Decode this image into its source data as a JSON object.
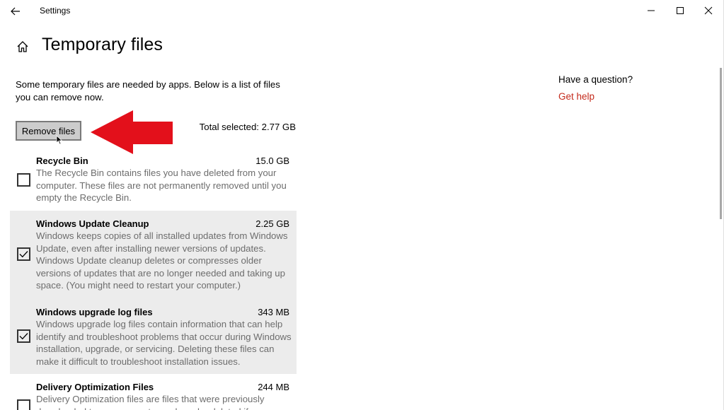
{
  "window": {
    "title": "Settings"
  },
  "page": {
    "title": "Temporary files",
    "intro": "Some temporary files are needed by apps. Below is a list of files you can remove now.",
    "remove_button": "Remove files",
    "total_selected": "Total selected: 2.77 GB"
  },
  "sidebar": {
    "question": "Have a question?",
    "help_link": "Get help"
  },
  "items": [
    {
      "name": "Recycle Bin",
      "size": "15.0 GB",
      "checked": false,
      "description": "The Recycle Bin contains files you have deleted from your computer. These files are not permanently removed until you empty the Recycle Bin."
    },
    {
      "name": "Windows Update Cleanup",
      "size": "2.25 GB",
      "checked": true,
      "description": "Windows keeps copies of all installed updates from Windows Update, even after installing newer versions of updates. Windows Update cleanup deletes or compresses older versions of updates that are no longer needed and taking up space. (You might need to restart your computer.)"
    },
    {
      "name": "Windows upgrade log files",
      "size": "343 MB",
      "checked": true,
      "description": "Windows upgrade log files contain information that can help identify and troubleshoot problems that occur during Windows installation, upgrade, or servicing.  Deleting these files can make it difficult to troubleshoot installation issues."
    },
    {
      "name": "Delivery Optimization Files",
      "size": "244 MB",
      "checked": false,
      "description": "Delivery Optimization files are files that were previously downloaded to your computer and can be deleted if"
    }
  ],
  "colors": {
    "accent_link": "#c42b1c",
    "arrow": "#e3101b",
    "selected_row": "#ececec"
  },
  "icons": [
    "back-arrow-icon",
    "home-icon",
    "minimize-icon",
    "maximize-icon",
    "close-icon",
    "checkmark-icon",
    "mouse-pointer-icon",
    "red-arrow-annotation"
  ]
}
